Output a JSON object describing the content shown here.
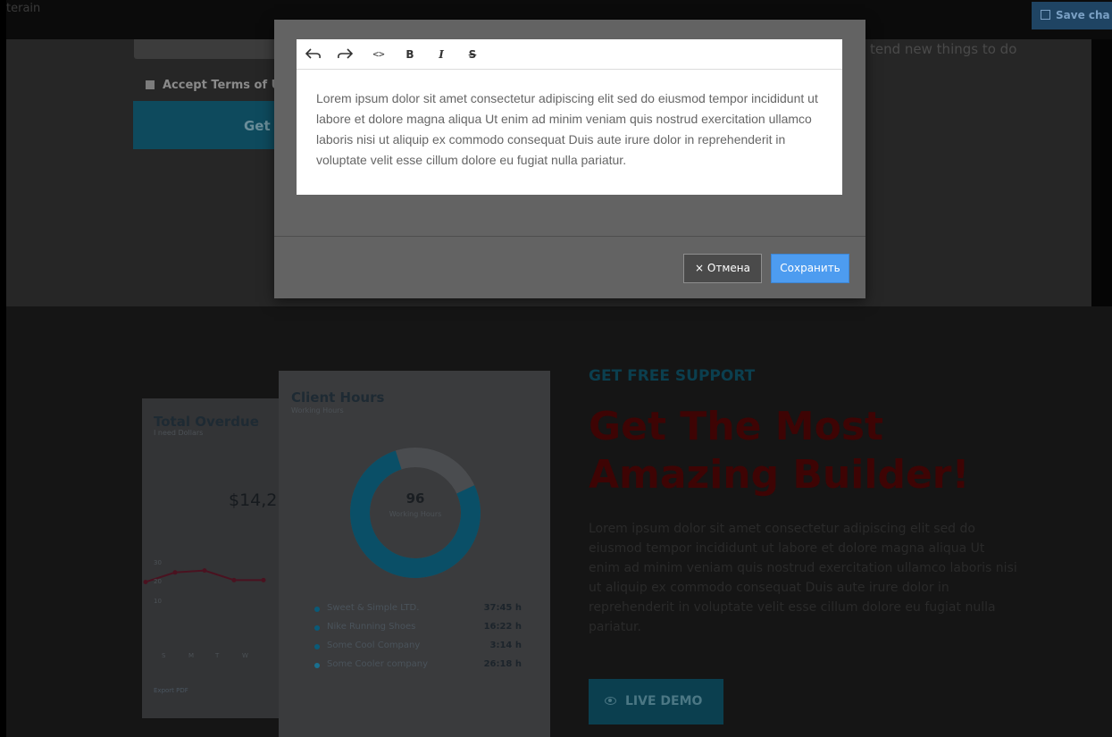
{
  "topbar": {
    "brand": "terain",
    "save_label": "Save cha"
  },
  "form": {
    "terms_label": "Accept Terms of U",
    "get_button": "Get"
  },
  "tend_text": "tend new things to do",
  "modal": {
    "toolbar": [
      {
        "name": "undo-icon",
        "glyph": "⇜"
      },
      {
        "name": "redo-icon",
        "glyph": "⇝"
      },
      {
        "name": "code-icon",
        "glyph": "<>"
      },
      {
        "name": "bold-icon",
        "glyph": "B"
      },
      {
        "name": "italic-icon",
        "glyph": "I"
      },
      {
        "name": "strikethrough-icon",
        "glyph": "S"
      }
    ],
    "content": "Lorem ipsum dolor sit amet consectetur adipiscing elit sed do eiusmod tempor incididunt ut labore et dolore magna aliqua Ut enim ad minim veniam quis nostrud exercitation ullamco laboris nisi ut aliquip ex commodo consequat Duis aute irure dolor in reprehenderit in voluptate velit esse cillum dolore eu fugiat nulla pariatur.",
    "cancel_label": "× Отмена",
    "save_label": "Сохранить"
  },
  "overdue_card": {
    "title": "Total Overdue",
    "subtitle": "I need Dollars",
    "amount": "$14,2",
    "export": "Export PDF",
    "chart_data": {
      "type": "line",
      "categories": [
        "S",
        "M",
        "T",
        "W"
      ],
      "x_ticks": [
        "S",
        "M",
        "T",
        "W"
      ],
      "y_ticks": [
        "30",
        "20",
        "10"
      ],
      "ylim": [
        0,
        30
      ],
      "series": [
        {
          "values": [
            19,
            24,
            25,
            20,
            20
          ]
        }
      ]
    }
  },
  "hours_card": {
    "title": "Client Hours",
    "subtitle": "Working Hours",
    "donut_value": "96",
    "donut_label": "Working Hours",
    "legend": [
      {
        "name": "Sweet & Simple LTD.",
        "value": "37:45 h",
        "color": "#0a5a78"
      },
      {
        "name": "Nike Running Shoes",
        "value": "16:22 h",
        "color": "#0a5a78"
      },
      {
        "name": "Some Cool Company",
        "value": "3:14 h",
        "color": "#0a5a78"
      },
      {
        "name": "Some Cooler company",
        "value": "26:18 h",
        "color": "#1a6f8e"
      }
    ]
  },
  "hero": {
    "kicker": "GET FREE SUPPORT",
    "headline": "Get The Most Amazing Builder!",
    "body": "Lorem ipsum dolor sit amet consectetur adipiscing elit sed do eiusmod tempor incididunt ut labore et dolore magna aliqua Ut enim ad minim veniam quis nostrud exercitation ullamco laboris nisi ut aliquip ex commodo consequat Duis aute irure dolor in reprehenderit in voluptate velit esse cillum dolore eu fugiat nulla pariatur.",
    "cta": "LIVE DEMO"
  },
  "colors": {
    "accent": "#4d9cf0",
    "teal": "#0b3f4f",
    "headline_red": "#3e0404"
  }
}
